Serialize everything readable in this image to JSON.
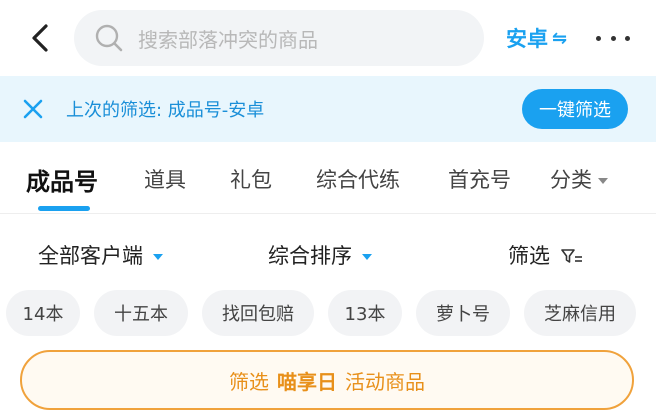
{
  "header": {
    "search_placeholder": "搜索部落冲突的商品",
    "platform": "安卓",
    "swap_glyph": "⇋"
  },
  "last_filter": {
    "text": "上次的筛选: 成品号-安卓",
    "button": "一键筛选"
  },
  "tabs": [
    {
      "label": "成品号",
      "active": true
    },
    {
      "label": "道具"
    },
    {
      "label": "礼包"
    },
    {
      "label": "综合代练"
    },
    {
      "label": "首充号"
    },
    {
      "label": "分类"
    }
  ],
  "sort": {
    "client": "全部客户端",
    "order": "综合排序",
    "filter": "筛选"
  },
  "chips": [
    "14本",
    "十五本",
    "找回包赔",
    "13本",
    "萝卜号",
    "芝麻信用"
  ],
  "promo": {
    "prefix": "筛选",
    "highlight": "喵享日",
    "suffix": "活动商品"
  },
  "colors": {
    "accent": "#1aa1f0",
    "promo": "#e8901a"
  }
}
